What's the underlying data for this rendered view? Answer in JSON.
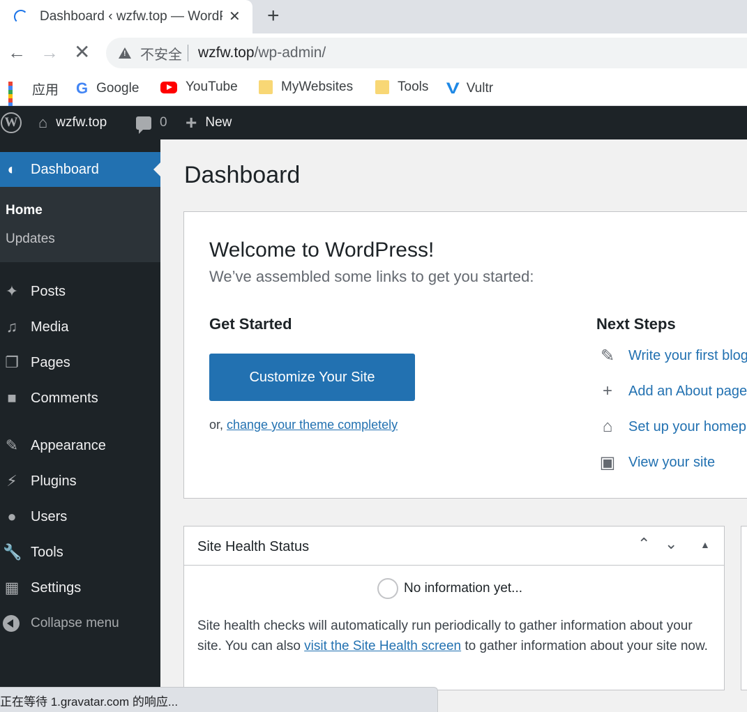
{
  "browser": {
    "tab_title": "Dashboard ‹ wzfw.top — WordPress",
    "tab_close": "✕",
    "new_tab": "+",
    "insecure_label": "不安全",
    "url_host": "wzfw.top",
    "url_path": "/wp-admin/",
    "bookmarks": [
      {
        "label": "应用",
        "icon": "apps-grid-icon"
      },
      {
        "label": "Google",
        "icon": "google-icon"
      },
      {
        "label": "YouTube",
        "icon": "youtube-icon"
      },
      {
        "label": "MyWebsites",
        "icon": "folder-icon"
      },
      {
        "label": "Tools",
        "icon": "folder-icon"
      },
      {
        "label": "Vultr",
        "icon": "vultr-icon"
      }
    ],
    "status_text": "正在等待 1.gravatar.com 的响应..."
  },
  "adminbar": {
    "site_name": "wzfw.top",
    "comments_count": "0",
    "new_label": "New"
  },
  "sidebar": {
    "current": "Dashboard",
    "submenu": [
      "Home",
      "Updates"
    ],
    "items": [
      {
        "label": "Posts",
        "icon": "pin-icon"
      },
      {
        "label": "Media",
        "icon": "media-icon"
      },
      {
        "label": "Pages",
        "icon": "pages-icon"
      },
      {
        "label": "Comments",
        "icon": "comment-icon"
      },
      {
        "label": "Appearance",
        "icon": "brush-icon"
      },
      {
        "label": "Plugins",
        "icon": "plug-icon"
      },
      {
        "label": "Users",
        "icon": "user-icon"
      },
      {
        "label": "Tools",
        "icon": "wrench-icon"
      },
      {
        "label": "Settings",
        "icon": "settings-icon"
      }
    ],
    "collapse_label": "Collapse menu"
  },
  "main": {
    "page_title": "Dashboard",
    "welcome": {
      "title": "Welcome to WordPress!",
      "about": "We’ve assembled some links to get you started:",
      "get_started_title": "Get Started",
      "customize_button": "Customize Your Site",
      "or_text": "or, ",
      "change_theme_link": "change your theme completely",
      "next_steps_title": "Next Steps",
      "next_steps": [
        {
          "label": "Write your first blog post",
          "icon": "edit-icon"
        },
        {
          "label": "Add an About page",
          "icon": "plus-icon"
        },
        {
          "label": "Set up your homepage",
          "icon": "home-icon"
        },
        {
          "label": "View your site",
          "icon": "view-icon"
        }
      ]
    },
    "site_health": {
      "title": "Site Health Status",
      "status": "No information yet...",
      "desc_before": "Site health checks will automatically run periodically to gather information about your site. You can also ",
      "desc_link": "visit the Site Health screen",
      "desc_after": " to gather information about your site now."
    }
  },
  "colors": {
    "wp_blue": "#2271b1",
    "admin_dark": "#1d2327",
    "submenu_bg": "#2c3338"
  }
}
